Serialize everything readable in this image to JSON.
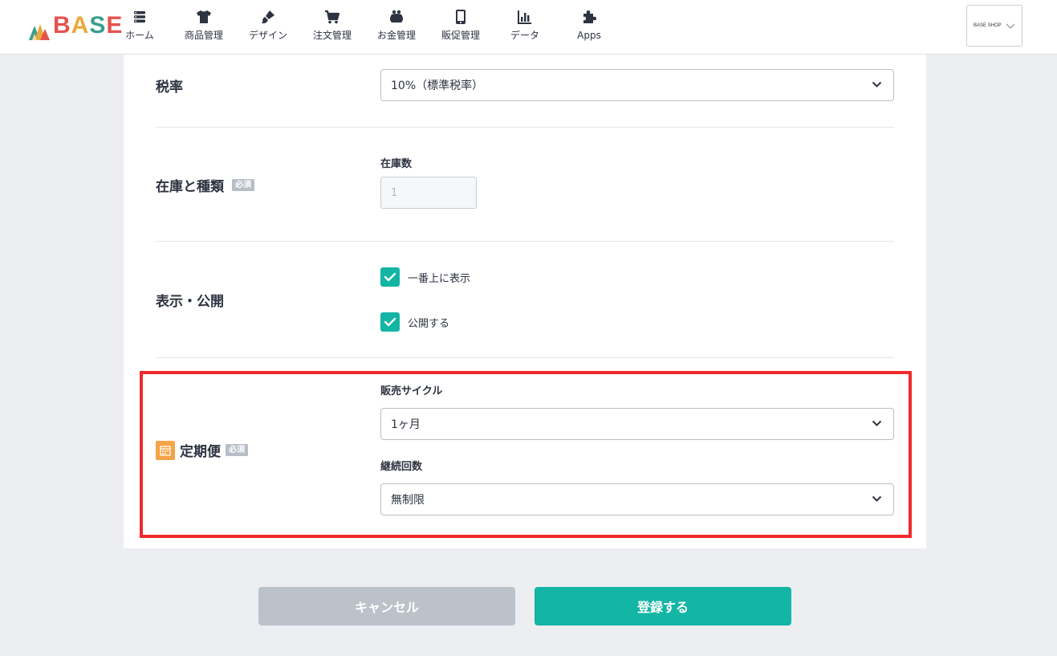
{
  "header": {
    "logo_text": "BASE",
    "nav": [
      {
        "label": "ホーム",
        "icon": "home-list-icon"
      },
      {
        "label": "商品管理",
        "icon": "tshirt-icon"
      },
      {
        "label": "デザイン",
        "icon": "brush-icon"
      },
      {
        "label": "注文管理",
        "icon": "cart-icon"
      },
      {
        "label": "お金管理",
        "icon": "purse-icon"
      },
      {
        "label": "販促管理",
        "icon": "smartphone-icon"
      },
      {
        "label": "データ",
        "icon": "bar-chart-icon"
      },
      {
        "label": "Apps",
        "icon": "puzzle-icon"
      }
    ],
    "shop_name": "BASE SHOP"
  },
  "form": {
    "tax": {
      "title": "税率",
      "value": "10%（標準税率）"
    },
    "stock": {
      "title": "在庫と種類",
      "required": "必須",
      "field_label": "在庫数",
      "placeholder": "1"
    },
    "visibility": {
      "title": "表示・公開",
      "options": [
        {
          "label": "一番上に表示",
          "checked": true
        },
        {
          "label": "公開する",
          "checked": true
        }
      ]
    },
    "subscription": {
      "title": "定期便",
      "required": "必須",
      "cycle_label": "販売サイクル",
      "cycle_value": "1ヶ月",
      "count_label": "継続回数",
      "count_value": "無制限"
    }
  },
  "buttons": {
    "cancel": "キャンセル",
    "submit": "登録する"
  },
  "colors": {
    "accent": "#13b5a4",
    "highlight": "#f02a2a",
    "badge": "#b8bec8",
    "subscription_icon": "#f5a447"
  }
}
